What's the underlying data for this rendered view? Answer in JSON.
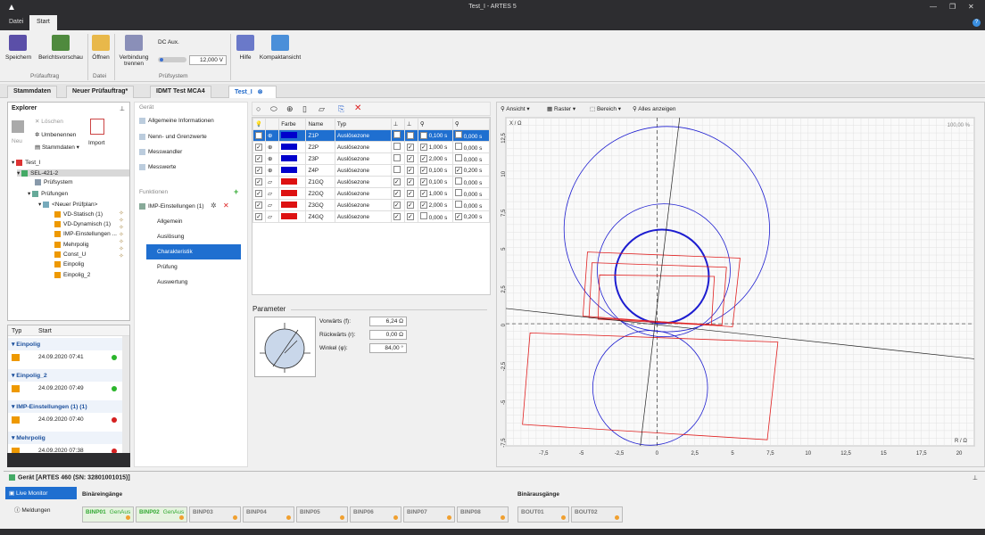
{
  "window": {
    "title": "Test_I - ARTES 5",
    "file": "Test_I",
    "app": "ARTES 5"
  },
  "menu": {
    "tabs": [
      "Datei",
      "Start"
    ]
  },
  "ribbon": {
    "buttons": {
      "save": "Speichern",
      "report": "Berichtsvorschau",
      "open": "Öffnen",
      "disconnect": "Verbindung trennen",
      "help": "Hilfe",
      "compact": "Kompaktansicht"
    },
    "dc_aux_label": "DC Aux.",
    "dc_aux_value": "12,000 V",
    "groups": {
      "g1": "Prüfauftrag",
      "g2": "Datei",
      "g3": "Prüfsystem"
    }
  },
  "doc_tabs": [
    "Stammdaten",
    "Neuer Prüfauftrag*",
    "IDMT Test MCA4",
    "Test_I"
  ],
  "explorer": {
    "title": "Explorer",
    "toolbar": {
      "new": "Neu",
      "delete": "Löschen",
      "rename": "Umbenennen",
      "master": "Stammdaten",
      "import": "Import"
    },
    "tree": [
      "Test_I",
      "SEL-421-2",
      "Prüfsystem",
      "Prüfungen",
      "<Neuer Prüfplan>",
      "VD-Statisch (1)",
      "VD-Dynamisch (1)",
      "IMP-Einstellungen ...",
      "Mehrpolig",
      "Const_U",
      "Einpolig",
      "Einpolig_2"
    ]
  },
  "history": {
    "columns": [
      "Typ",
      "Start"
    ],
    "groups": [
      {
        "name": "Einpolig",
        "date": "24.09.2020 07:41",
        "status": "ok"
      },
      {
        "name": "Einpolig_2",
        "date": "24.09.2020 07:49",
        "status": "ok"
      },
      {
        "name": "IMP-Einstellungen (1) (1)",
        "date": "24.09.2020 07:40",
        "status": "fail"
      },
      {
        "name": "Mehrpolig",
        "date": "24.09.2020 07:38",
        "status": "fail"
      }
    ]
  },
  "nav": {
    "device_header": "Gerät",
    "device_items": [
      "Allgemeine Informationen",
      "Nenn- und Grenzwerte",
      "Messwandler",
      "Messwerte"
    ],
    "functions_header": "Funktionen",
    "function": "IMP-Einstellungen (1)",
    "sub_items": [
      "Allgemein",
      "Auslösung",
      "Charakteristik",
      "Prüfung",
      "Auswertung"
    ]
  },
  "zones_table": {
    "columns": [
      "Farbe",
      "Name",
      "Typ"
    ],
    "rows": [
      {
        "name": "Z1P",
        "type": "Auslösezone",
        "t": "0,100 s",
        "t2": "0,000 s",
        "color": "#0000cc"
      },
      {
        "name": "Z2P",
        "type": "Auslösezone",
        "t": "1,000 s",
        "t2": "0,000 s",
        "color": "#0000cc"
      },
      {
        "name": "Z3P",
        "type": "Auslösezone",
        "t": "2,000 s",
        "t2": "0,000 s",
        "color": "#0000cc"
      },
      {
        "name": "Z4P",
        "type": "Auslösezone",
        "t": "0,100 s",
        "t2": "0,200 s",
        "color": "#0000cc"
      },
      {
        "name": "Z1GQ",
        "type": "Auslösezone",
        "t": "0,100 s",
        "t2": "0,000 s",
        "color": "#dd1111"
      },
      {
        "name": "Z2GQ",
        "type": "Auslösezone",
        "t": "1,000 s",
        "t2": "0,000 s",
        "color": "#dd1111"
      },
      {
        "name": "Z3GQ",
        "type": "Auslösezone",
        "t": "2,000 s",
        "t2": "0,000 s",
        "color": "#dd1111"
      },
      {
        "name": "Z4GQ",
        "type": "Auslösezone",
        "t": "0,000 s",
        "t2": "0,200 s",
        "color": "#dd1111"
      }
    ]
  },
  "parameter": {
    "title": "Parameter",
    "fwd_label": "Vorwärts (f):",
    "fwd_value": "6,24 Ω",
    "rev_label": "Rückwärts (r):",
    "rev_value": "0,00 Ω",
    "angle_label": "Winkel (φ):",
    "angle_value": "84,00 °"
  },
  "diagram": {
    "toolbar": {
      "view": "Ansicht",
      "grid": "Raster",
      "range": "Bereich",
      "show_all": "Alles anzeigen"
    },
    "y_label": "X / Ω",
    "x_label": "R / Ω",
    "zoom": "100,00 %",
    "x_ticks": [
      "-7,5",
      "-5",
      "-2,5",
      "0",
      "2,5",
      "5",
      "7,5",
      "10",
      "12,5",
      "15",
      "17,5",
      "20"
    ],
    "y_ticks": [
      "12,5",
      "10",
      "7,5",
      "5",
      "2,5",
      "0",
      "-2,5",
      "-5",
      "-7,5"
    ]
  },
  "bottom": {
    "title": "Gerät [ARTES 460 (SN: 32801001015)]",
    "live": "Live Monitor",
    "messages": "Meldungen",
    "bin_in_label": "Binäreingänge",
    "bin_out_label": "Binärausgänge",
    "bin_in": [
      "BINP01",
      "BINP02",
      "BINP03",
      "BINP04",
      "BINP05",
      "BINP06",
      "BINP07",
      "BINP08"
    ],
    "bin_in_sub": [
      "GenAus",
      "GenAus"
    ],
    "bin_out": [
      "BOUT01",
      "BOUT02"
    ]
  }
}
